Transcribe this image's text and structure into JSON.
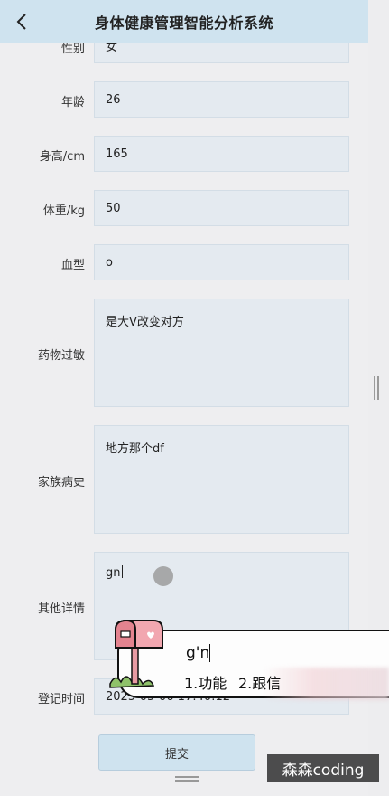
{
  "header": {
    "title": "身体健康管理智能分析系统",
    "back_icon": "chevron-left-icon"
  },
  "form": {
    "gender": {
      "label": "性别",
      "value": "女"
    },
    "age": {
      "label": "年龄",
      "value": "26"
    },
    "height": {
      "label": "身高/cm",
      "value": "165"
    },
    "weight": {
      "label": "体重/kg",
      "value": "50"
    },
    "blood_type": {
      "label": "血型",
      "value": "o"
    },
    "drug_allergy": {
      "label": "药物过敏",
      "value": "是大V改变对方"
    },
    "family_history": {
      "label": "家族病史",
      "value": "地方那个df"
    },
    "other_details": {
      "label": "其他详情",
      "value": "gn"
    },
    "register_time": {
      "label": "登记时间",
      "value": "2025-05-06 17:40:12"
    },
    "submit_label": "提交"
  },
  "ime": {
    "composition": "g'n",
    "candidates": [
      "1.功能",
      "2.跟信"
    ]
  },
  "watermark": "森森coding",
  "colors": {
    "header_bg": "#cfe3ef",
    "input_bg": "#e4eaf0",
    "page_bg": "#eeeef0"
  }
}
